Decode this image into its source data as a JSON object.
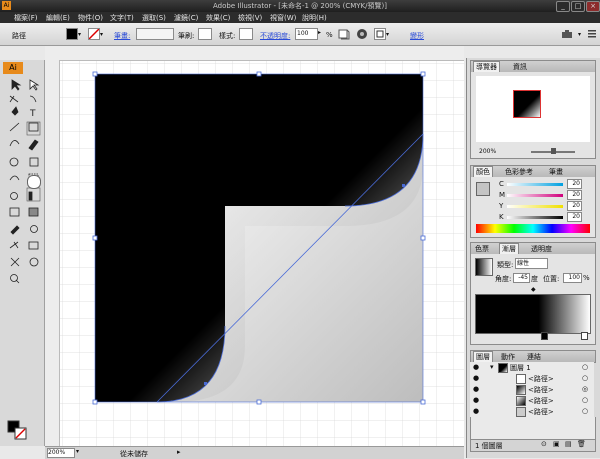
{
  "window": {
    "title": "Adobe Illustrator - [未命名-1 @ 200% (CMYK/預覽)]",
    "min": "_",
    "max": "□",
    "close": "×"
  },
  "menu": [
    "檔案(F)",
    "編輯(E)",
    "物件(O)",
    "文字(T)",
    "選取(S)",
    "濾鏡(C)",
    "效果(C)",
    "檢視(V)",
    "視窗(W)",
    "說明(H)"
  ],
  "control": {
    "object_label": "路徑",
    "stroke_label": "筆畫:",
    "brush_label": "筆刷:",
    "style_label": "樣式:",
    "opacity_label": "不透明度:",
    "opacity_value": "100",
    "pct": "%",
    "transform_label": "變形"
  },
  "status": {
    "zoom": "200%",
    "state": "從未儲存"
  },
  "navigator": {
    "tabs": [
      "導覽器",
      "資訊"
    ],
    "zoom": "200%"
  },
  "color_panel": {
    "tabs": [
      "顏色",
      "色彩參考",
      "筆畫"
    ],
    "channels": [
      {
        "k": "C",
        "v": "20"
      },
      {
        "k": "M",
        "v": "20"
      },
      {
        "k": "Y",
        "v": "20"
      },
      {
        "k": "K",
        "v": "20"
      }
    ]
  },
  "gradient_panel": {
    "tabs": [
      "色票",
      "漸層",
      "透明度"
    ],
    "type_label": "類型:",
    "type_value": "線性",
    "angle_label": "角度:",
    "angle_value": "-45",
    "angle_unit": "度",
    "position_label": "位置:",
    "position_value": "100",
    "pct": "%"
  },
  "layers_panel": {
    "tabs": [
      "圖層",
      "動作",
      "連結"
    ],
    "rows": [
      {
        "name": "圖層 1"
      },
      {
        "name": "<路徑>"
      },
      {
        "name": "<路徑>"
      },
      {
        "name": "<路徑>"
      },
      {
        "name": "<路徑>"
      }
    ],
    "footer": "1 個圖層"
  },
  "colors": {
    "accent_blue": "#2a4bd7",
    "selection": "#4a6bd6"
  }
}
